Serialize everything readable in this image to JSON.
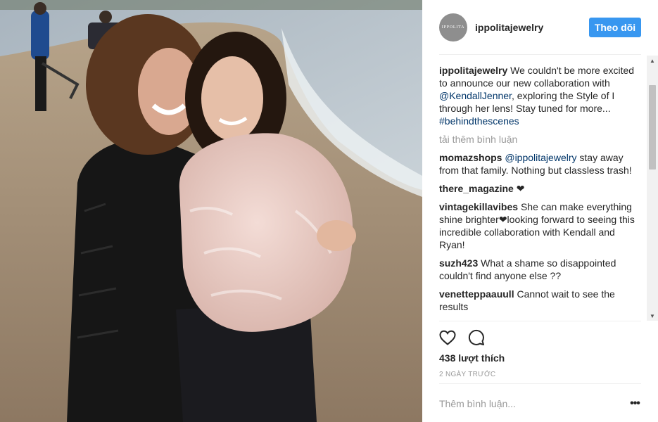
{
  "post": {
    "image_alt": "Two women smiling on a beach",
    "account": {
      "username": "ippolitajewelry",
      "avatar_text": "IPPOLITA"
    },
    "follow_label": "Theo dõi",
    "caption": {
      "user": "ippolitajewelry",
      "text_a": " We couldn't be more excited to announce our new collaboration with ",
      "mention": "@KendallJenner",
      "text_b": ", exploring the Style of I through her lens! Stay tuned for more...",
      "hashtag": "#behindthescenes"
    },
    "load_more": "tải thêm bình luận",
    "comments": [
      {
        "user": "momazshops",
        "mention": "@ippolitajewelry",
        "text": " stay away from that family. Nothing but classless trash!"
      },
      {
        "user": "there_magazine",
        "mention": "",
        "text": " ❤"
      },
      {
        "user": "vintagekillavibes",
        "mention": "",
        "text": " She can make everything shine brighter❤looking forward to seeing this incredible collaboration with Kendall and Ryan!"
      },
      {
        "user": "suzh423",
        "mention": "",
        "text": " What a shame so disappointed couldn't find anyone else ??"
      },
      {
        "user": "venetteppaauull",
        "mention": "",
        "text": " Cannot wait to see the results"
      }
    ],
    "likes": "438 lượt thích",
    "time": "2 NGÀY TRƯỚC",
    "comment_placeholder": "Thêm bình luận...",
    "more_label": "•••",
    "icons": {
      "like": "heart-icon",
      "comment": "speech-bubble-icon",
      "more": "ellipsis-icon"
    },
    "colors": {
      "follow_button": "#3897f0",
      "link": "#003569",
      "muted": "#999999"
    }
  }
}
